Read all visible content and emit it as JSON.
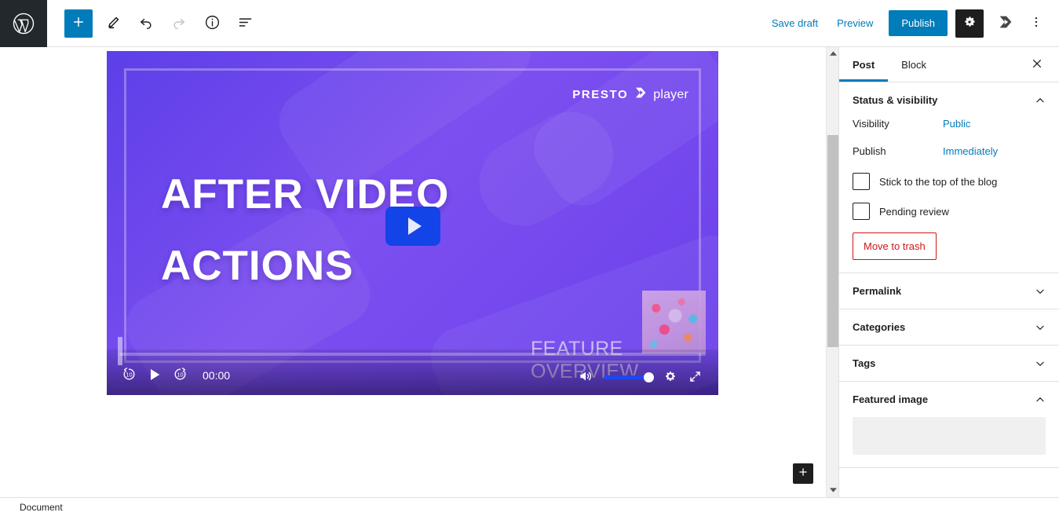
{
  "topbar": {
    "logo_icon": "wordpress-logo-icon",
    "add_block_label": "+",
    "tools": [
      {
        "name": "add-block-button",
        "icon": "plus-icon",
        "label": "Add block"
      },
      {
        "name": "edit-mode-button",
        "icon": "pencil-icon",
        "label": "Tools"
      },
      {
        "name": "undo-button",
        "icon": "undo-arrow-icon",
        "label": "Undo"
      },
      {
        "name": "redo-button",
        "icon": "redo-arrow-icon",
        "label": "Redo"
      },
      {
        "name": "details-button",
        "icon": "info-circle-icon",
        "label": "Details"
      },
      {
        "name": "list-view-button",
        "icon": "list-view-icon",
        "label": "List view"
      }
    ],
    "save_draft_label": "Save draft",
    "preview_label": "Preview",
    "publish_label": "Publish",
    "settings_icon": "gear-icon",
    "plugin_icon": "presto-player-plugin-icon",
    "more_icon": "kebab-menu-icon"
  },
  "video": {
    "brand_primary": "PRESTO",
    "brand_secondary": "player",
    "brand_icon": "presto-player-logo-icon",
    "title_line1": "AFTER VIDEO",
    "title_line2": "ACTIONS",
    "subtitle": "FEATURE OVERVIEW",
    "play_icon": "play-triangle-icon",
    "controls": {
      "rewind_label": "10",
      "rewind_icon": "rewind-10-icon",
      "play_icon": "play-icon",
      "forward_label": "10",
      "forward_icon": "forward-10-icon",
      "time": "00:00",
      "volume_icon": "volume-on-icon",
      "volume_value": 88,
      "settings_icon": "gear-icon",
      "fullscreen_icon": "fullscreen-expand-icon"
    },
    "colors": {
      "bg_start": "#5d3fe8",
      "bg_end": "#6a40ea",
      "play_button": "#1344e8",
      "volume_fill": "#1f47f0"
    }
  },
  "canvas": {
    "float_add_label": "+",
    "float_add_icon": "plus-icon",
    "grammarly_icon": "grammarly-logo-icon"
  },
  "sidebar": {
    "tabs": [
      {
        "label": "Post",
        "active": true
      },
      {
        "label": "Block",
        "active": false
      }
    ],
    "close_icon": "close-x-icon",
    "panels": [
      {
        "title": "Status & visibility",
        "expanded": true
      },
      {
        "title": "Permalink",
        "expanded": false
      },
      {
        "title": "Categories",
        "expanded": false
      },
      {
        "title": "Tags",
        "expanded": false
      },
      {
        "title": "Featured image",
        "expanded": true
      }
    ],
    "status": {
      "visibility_label": "Visibility",
      "visibility_value": "Public",
      "publish_label": "Publish",
      "publish_value": "Immediately",
      "sticky_label": "Stick to the top of the blog",
      "pending_label": "Pending review",
      "trash_label": "Move to trash"
    }
  },
  "bottombar": {
    "document_label": "Document"
  }
}
